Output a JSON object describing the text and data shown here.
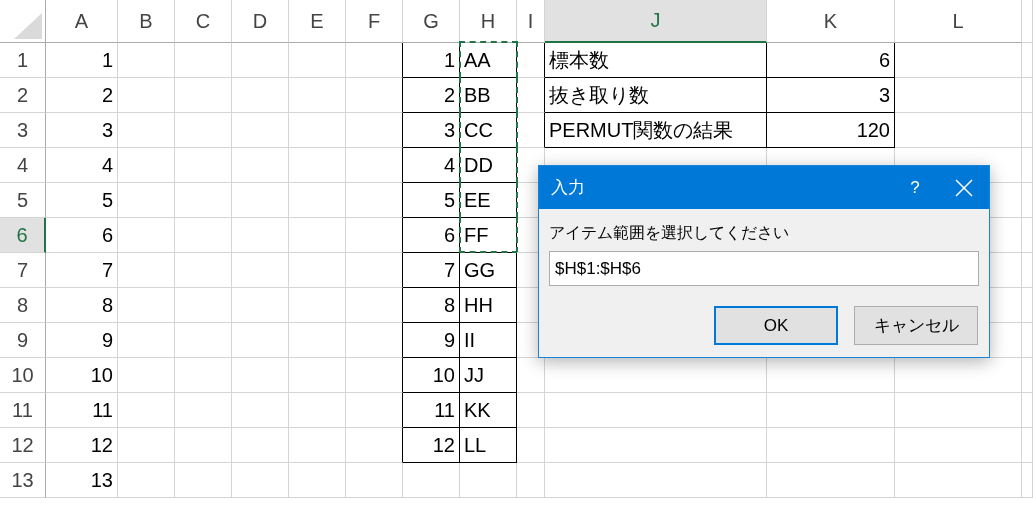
{
  "columns": [
    {
      "label": "A",
      "selected": false
    },
    {
      "label": "B",
      "selected": false
    },
    {
      "label": "C",
      "selected": false
    },
    {
      "label": "D",
      "selected": false
    },
    {
      "label": "E",
      "selected": false
    },
    {
      "label": "F",
      "selected": false
    },
    {
      "label": "G",
      "selected": false
    },
    {
      "label": "H",
      "selected": false
    },
    {
      "label": "I",
      "selected": false
    },
    {
      "label": "J",
      "selected": true
    },
    {
      "label": "K",
      "selected": false
    },
    {
      "label": "L",
      "selected": false
    }
  ],
  "rows": [
    {
      "label": "1",
      "selected": false
    },
    {
      "label": "2",
      "selected": false
    },
    {
      "label": "3",
      "selected": false
    },
    {
      "label": "4",
      "selected": false
    },
    {
      "label": "5",
      "selected": false
    },
    {
      "label": "6",
      "selected": true
    },
    {
      "label": "7",
      "selected": false
    },
    {
      "label": "8",
      "selected": false
    },
    {
      "label": "9",
      "selected": false
    },
    {
      "label": "10",
      "selected": false
    },
    {
      "label": "11",
      "selected": false
    },
    {
      "label": "12",
      "selected": false
    },
    {
      "label": "13",
      "selected": false
    }
  ],
  "column_a_values": [
    "1",
    "2",
    "3",
    "4",
    "5",
    "6",
    "7",
    "8",
    "9",
    "10",
    "11",
    "12",
    "13"
  ],
  "item_table": [
    {
      "number": "1",
      "item": "AA",
      "in_range": true
    },
    {
      "number": "2",
      "item": "BB",
      "in_range": true
    },
    {
      "number": "3",
      "item": "CC",
      "in_range": true
    },
    {
      "number": "4",
      "item": "DD",
      "in_range": true
    },
    {
      "number": "5",
      "item": "EE",
      "in_range": true
    },
    {
      "number": "6",
      "item": "FF",
      "in_range": true
    },
    {
      "number": "7",
      "item": "GG",
      "in_range": false
    },
    {
      "number": "8",
      "item": "HH",
      "in_range": false
    },
    {
      "number": "9",
      "item": "II",
      "in_range": false
    },
    {
      "number": "10",
      "item": "JJ",
      "in_range": false
    },
    {
      "number": "11",
      "item": "KK",
      "in_range": false
    },
    {
      "number": "12",
      "item": "LL",
      "in_range": false
    }
  ],
  "summary_table": [
    {
      "label": "標本数",
      "value": "6"
    },
    {
      "label": "抜き取り数",
      "value": "3"
    },
    {
      "label": "PERMUT関数の結果",
      "value": "120"
    }
  ],
  "dialog": {
    "title": "入力",
    "help": "?",
    "prompt": "アイテム範囲を選択してください",
    "input": {
      "value": "$H$1:$H$6"
    },
    "buttons": [
      {
        "label": "OK",
        "default": true
      },
      {
        "label": "キャンセル",
        "default": false
      }
    ]
  }
}
